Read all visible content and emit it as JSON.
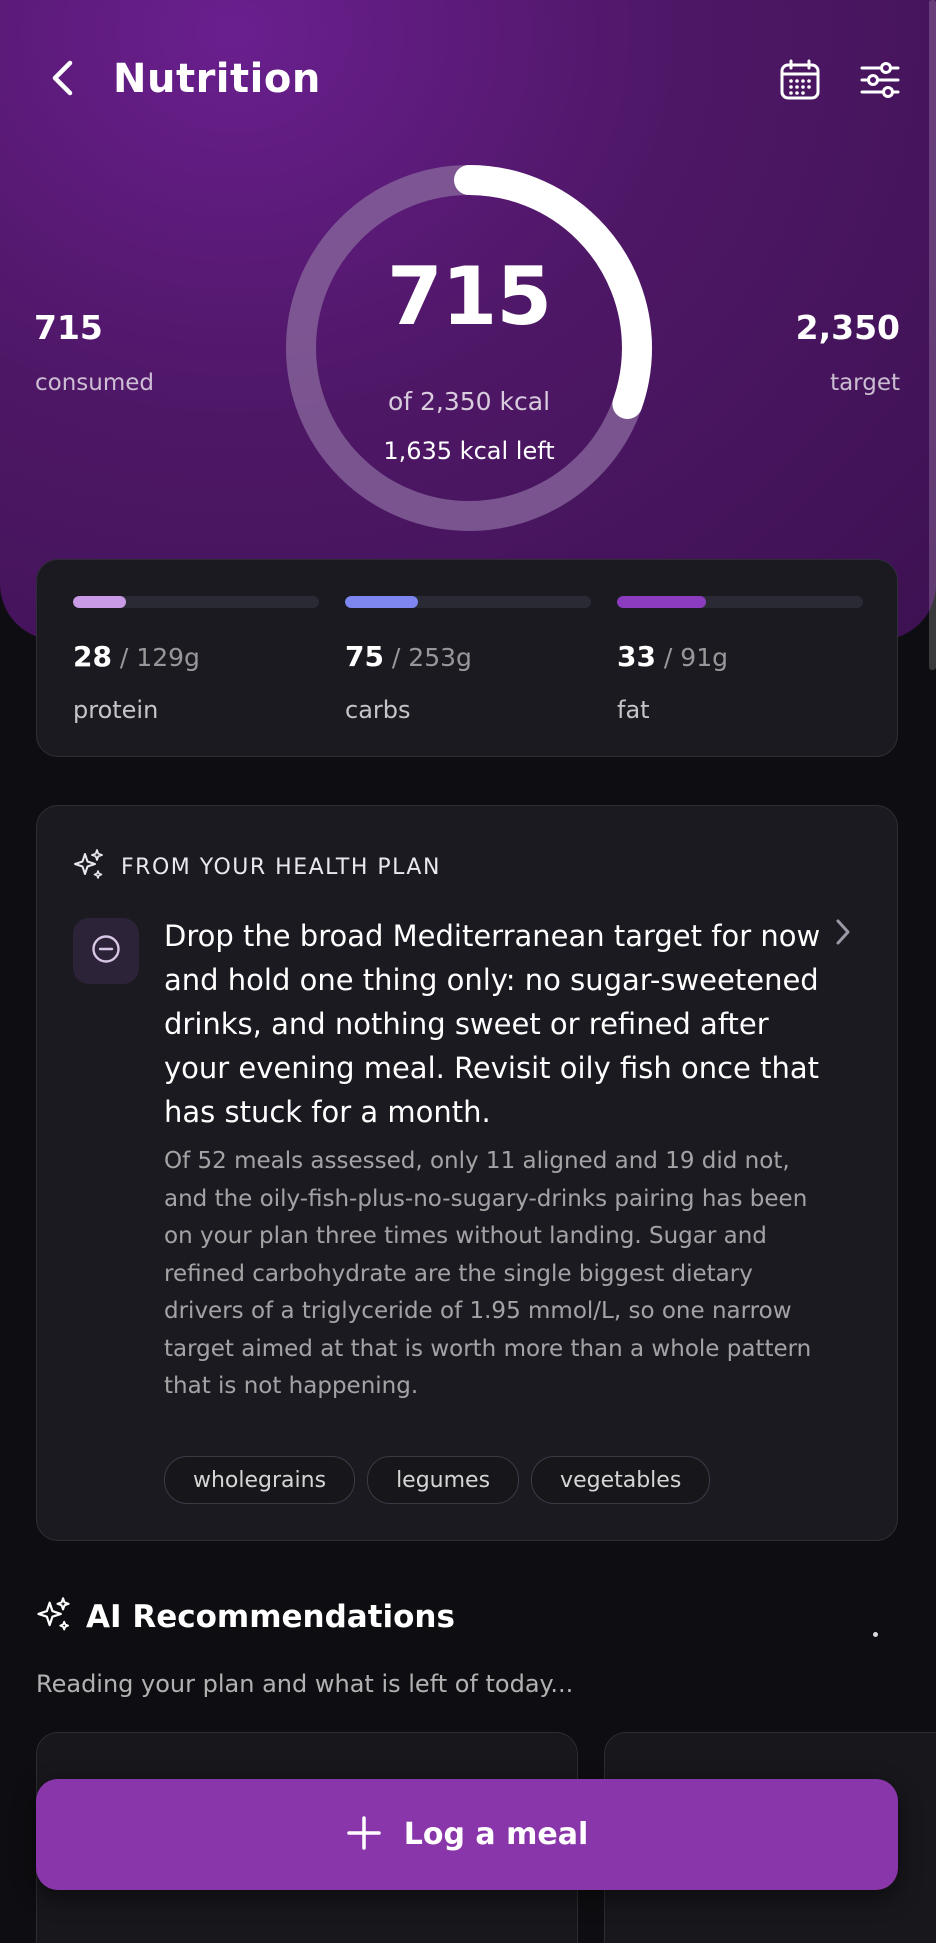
{
  "header": {
    "title": "Nutrition",
    "back_icon": "chevron-left-icon",
    "calendar_icon": "calendar-icon",
    "filter_icon": "sliders-icon"
  },
  "calories": {
    "consumed_value": "715",
    "consumed_label": "consumed",
    "target_value": "2,350",
    "target_label": "target",
    "ring_value": "715",
    "ring_subtitle": "of 2,350 kcal",
    "ring_left": "1,635 kcal left",
    "progress_fraction": 0.304,
    "ring_color": "#ffffff",
    "ring_track_color": "#8a6a9e"
  },
  "macros": [
    {
      "value": "28",
      "target": " / 129g",
      "label": "protein",
      "fraction": 0.217,
      "color": "#c99be6"
    },
    {
      "value": "75",
      "target": " / 253g",
      "label": "carbs",
      "fraction": 0.296,
      "color": "#7e86f0"
    },
    {
      "value": "33",
      "target": " / 91g",
      "label": "fat",
      "fraction": 0.363,
      "color": "#8c3dbf"
    }
  ],
  "health_plan": {
    "heading": "FROM YOUR HEALTH PLAN",
    "heading_icon": "sparkles-icon",
    "badge_icon": "minus-circle-icon",
    "title": "Drop the broad Mediterranean target for now and hold one thing only: no sugar-sweetened drinks, and nothing sweet or refined after your evening meal. Revisit oily fish once that has stuck for a month.",
    "body": "Of 52 meals assessed, only 11 aligned and 19 did not, and the oily-fish-plus-no-sugary-drinks pairing has been on your plan three times without landing. Sugar and refined carbohydrate are the single biggest dietary drivers of a triglyceride of 1.95 mmol/L, so one narrow target aimed at that is worth more than a whole pattern that is not happening.",
    "chips": [
      "wholegrains",
      "legumes",
      "vegetables"
    ]
  },
  "ai": {
    "title": "AI Recommendations",
    "subtitle": "Reading your plan and what is left of today..."
  },
  "log_button": {
    "label": "Log a meal",
    "icon": "plus-icon",
    "color": "#8a36ab"
  },
  "colors": {
    "background": "#0e0e12",
    "hero": "#4e1766",
    "card": "#1a1a20"
  }
}
